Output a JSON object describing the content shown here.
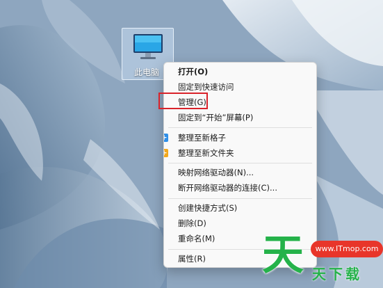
{
  "desktop": {
    "icon_label": "此电脑",
    "icon_name": "computer-icon"
  },
  "context_menu": {
    "items": [
      {
        "label": "打开(O)",
        "bold": true
      },
      {
        "label": "固定到快速访问"
      },
      {
        "label": "管理(G)",
        "highlighted": true
      },
      {
        "label": "固定到“开始”屏幕(P)"
      },
      {
        "label": "整理至新格子",
        "icon": "plus-icon",
        "icon_color": "#2f8fe8"
      },
      {
        "label": "整理至新文件夹",
        "icon": "plus-icon",
        "icon_color": "#f2a81d"
      },
      {
        "label": "映射网络驱动器(N)..."
      },
      {
        "label": "断开网络驱动器的连接(C)..."
      },
      {
        "label": "创建快捷方式(S)"
      },
      {
        "label": "删除(D)"
      },
      {
        "label": "重命名(M)"
      },
      {
        "label": "属性(R)"
      }
    ]
  },
  "annotation": {
    "highlight_color": "#d9222a"
  },
  "watermark": {
    "big_char": "天",
    "url": "www.ITmop.com",
    "small_text": "天下载",
    "green": "#25b24a",
    "red": "#e8352a"
  }
}
